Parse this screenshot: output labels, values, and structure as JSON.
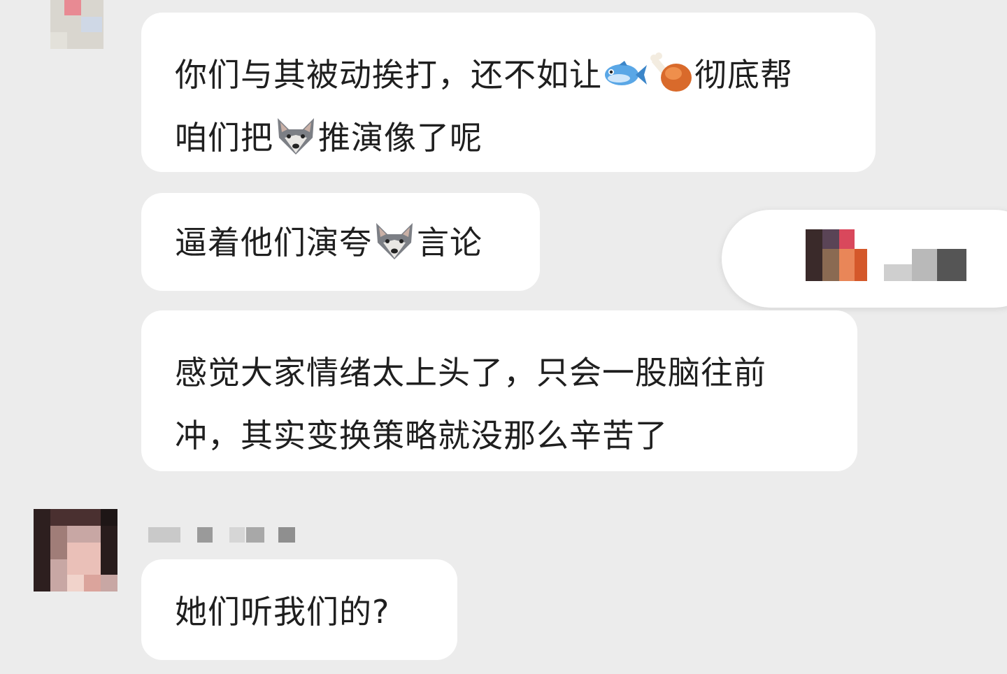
{
  "messages": [
    {
      "lines": [
        [
          "你们与其被动挨打，还不如让",
          "@fish",
          "@drumstick",
          "彻底帮"
        ],
        [
          "咱们把",
          "@wolf",
          "推演像了呢"
        ]
      ]
    },
    {
      "lines": [
        [
          "逼着他们演夸",
          "@wolf",
          "言论"
        ]
      ]
    },
    {
      "lines": [
        [
          "感觉大家情绪太上头了，只会一股脑往前"
        ],
        [
          "冲，其实变换策略就没那么辛苦了"
        ]
      ]
    },
    {
      "lines": [
        [
          "她们听我们的?"
        ]
      ]
    }
  ],
  "icons": {
    "fish": "fish-emoji-icon",
    "drumstick": "poultry-leg-emoji-icon",
    "wolf": "wolf-face-emoji-icon"
  },
  "colors": {
    "background": "#ececec",
    "bubble": "#ffffff",
    "text": "#1f1f1f"
  }
}
